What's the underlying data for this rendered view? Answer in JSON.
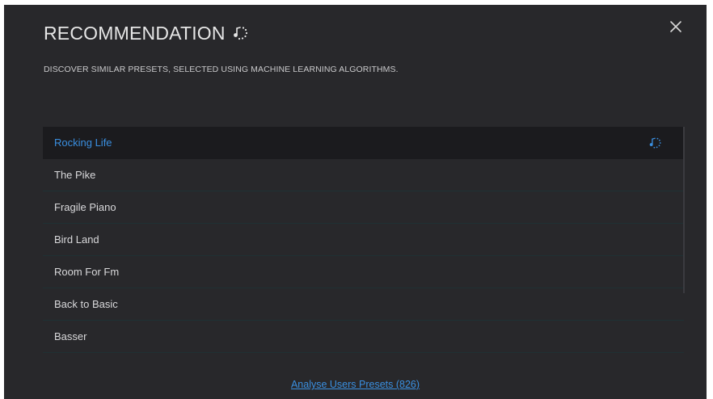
{
  "dialog": {
    "title": "RECOMMENDATION",
    "title_icon": "recommendation-note-icon",
    "close_icon": "close-icon",
    "subtitle": "DISCOVER SIMILAR PRESETS, SELECTED USING MACHINE LEARNING ALGORITHMS."
  },
  "presets": [
    {
      "label": "Rocking Life",
      "selected": true
    },
    {
      "label": "The Pike"
    },
    {
      "label": "Fragile Piano"
    },
    {
      "label": "Bird Land"
    },
    {
      "label": "Room For Fm"
    },
    {
      "label": "Back to Basic"
    },
    {
      "label": "Basser"
    }
  ],
  "footer": {
    "link_label": "Analyse Users Presets (826)"
  },
  "colors": {
    "background": "#28282b",
    "selected_row": "#1b1b1e",
    "accent": "#3a8fe0",
    "divider": "#1f3134"
  }
}
